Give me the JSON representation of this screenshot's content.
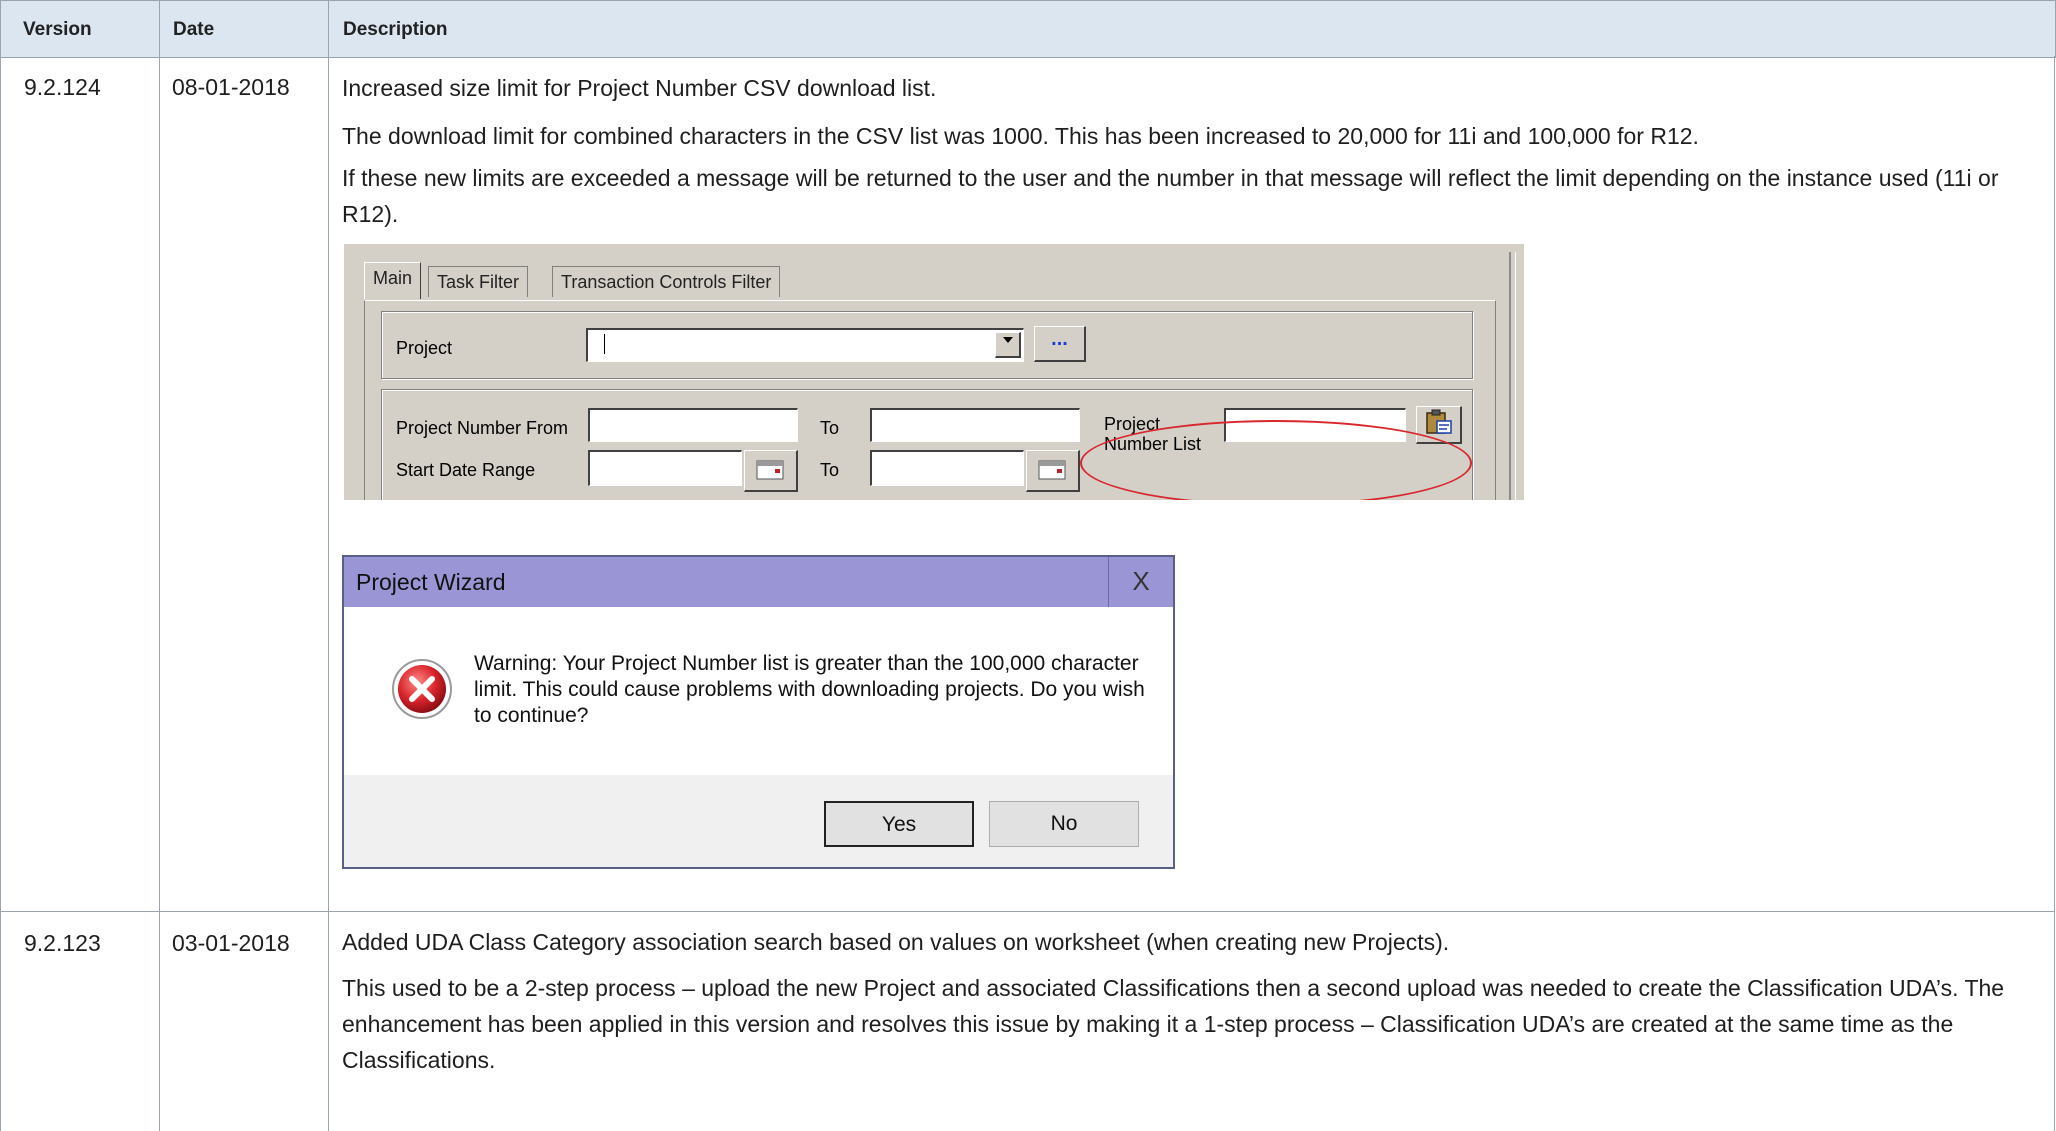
{
  "table": {
    "headers": {
      "version": "Version",
      "date": "Date",
      "description": "Description"
    },
    "rows": [
      {
        "version": "9.2.124",
        "date": "08-01-2018",
        "paragraphs": [
          "Increased size limit for Project Number CSV download list.",
          "The download limit for combined characters in the CSV list was 1000.  This has been increased to 20,000 for 11i and 100,000 for R12.",
          "If these new limits are exceeded a message will be returned to the user and the number in that message will reflect the limit depending on the instance used (11i or R12)."
        ]
      },
      {
        "version": "9.2.123",
        "date": "03-01-2018",
        "paragraphs": [
          "Added UDA Class Category association search based on values on worksheet (when creating new Projects).",
          "This used to be a 2-step process – upload the new Project and associated Classifications then a second upload was needed to create the Classification UDA’s.  The enhancement has been applied in this version and resolves this issue by making it a 1-step process – Classification UDA’s are created at the same time as the Classifications."
        ]
      }
    ]
  },
  "form": {
    "tabs": [
      "Main",
      "Task Filter",
      "Transaction Controls Filter"
    ],
    "active_tab": "Main",
    "project_label": "Project",
    "ellipsis": "...",
    "project_number_from_label": "Project Number From",
    "to_label": "To",
    "start_date_range_label": "Start Date Range",
    "project_number_list_label_1": "Project",
    "project_number_list_label_2": "Number List",
    "highlight_color": "#d9272e"
  },
  "dialog": {
    "title": "Project Wizard",
    "close": "X",
    "message": "Warning: Your Project Number list is greater than the 100,000 character limit. This could cause problems with downloading projects. Do you wish to continue?",
    "yes_label": "Yes",
    "no_label": "No",
    "title_bar_color": "#9a96d6"
  }
}
